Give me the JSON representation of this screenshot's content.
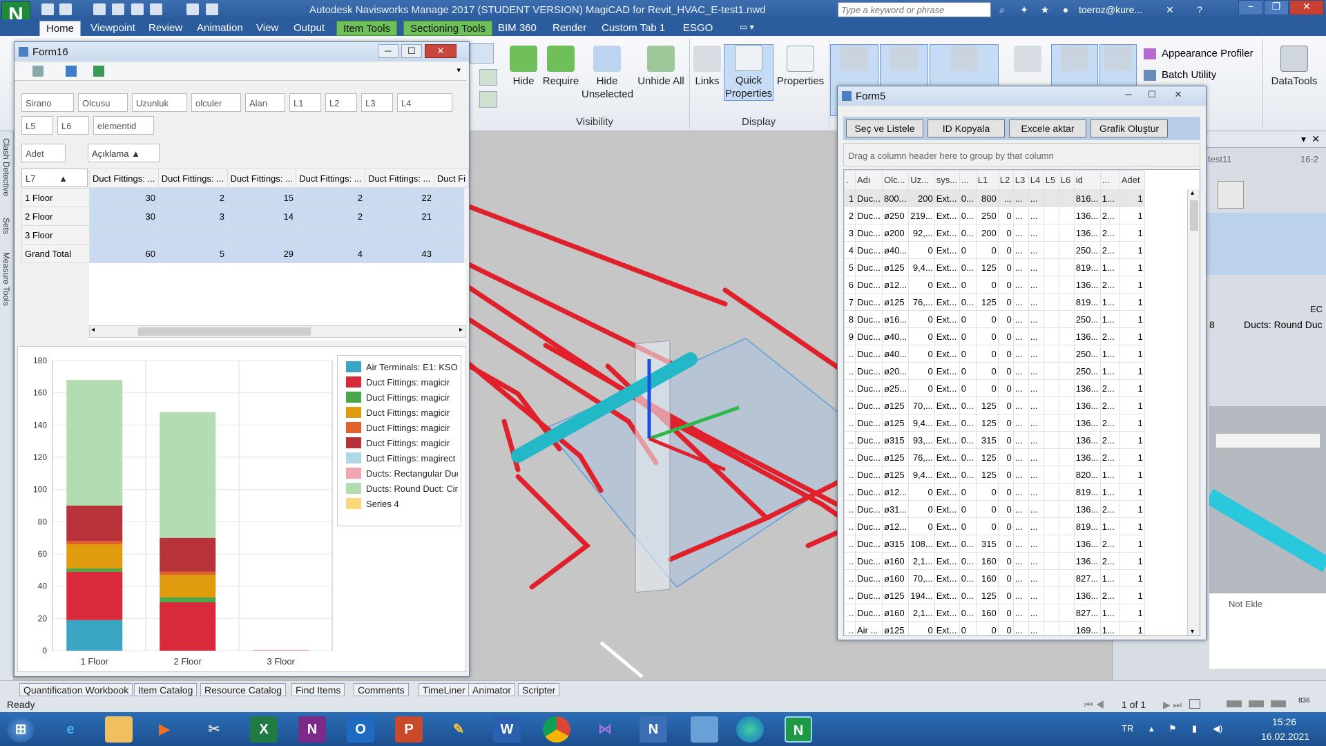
{
  "app": {
    "title": "Autodesk Navisworks Manage 2017 (STUDENT VERSION)    MagiCAD for Revit_HVAC_E-test1.nwd",
    "logo": "N",
    "search_placeholder": "Type a keyword or phrase",
    "user": "toeroz@kure...",
    "minimize": "−",
    "restore": "❐",
    "close": "✕"
  },
  "ribbon_tabs": [
    "Home",
    "Viewpoint",
    "Review",
    "Animation",
    "View",
    "Output",
    "Item Tools",
    "Sectioning Tools",
    "BIM 360",
    "Render",
    "Custom Tab 1",
    "ESGO"
  ],
  "ribbon": {
    "hide": "Hide",
    "require": "Require",
    "hide_unselected": "Hide Unselected",
    "unhide_all": "Unhide All",
    "links": "Links",
    "quick_properties": "Quick Properties",
    "properties": "Properties",
    "group_visibility": "Visibility",
    "group_display": "Display",
    "appearance_profiler": "Appearance Profiler",
    "batch_utility": "Batch Utility",
    "datatools": "DataTools"
  },
  "left_side_tabs": [
    "Clash Detective",
    "Sets",
    "Measure Tools"
  ],
  "form16": {
    "title": "Form16",
    "filter_fields": [
      "Sirano",
      "Olcusu",
      "Uzunluk",
      "olculer",
      "Alan",
      "L1",
      "L2",
      "L3",
      "L4",
      "L5",
      "L6",
      "elementid"
    ],
    "data_field": "Adet",
    "column_field": "Açıklama",
    "row_field": "L7",
    "column_headers": [
      "Duct Fittings: ...",
      "Duct Fittings: ...",
      "Duct Fittings: ...",
      "Duct Fittings: ...",
      "Duct Fittings: ...",
      "Duct Fi"
    ],
    "rows": [
      {
        "label": "1 Floor",
        "values": [
          "30",
          "2",
          "15",
          "2",
          "22",
          ""
        ]
      },
      {
        "label": "2 Floor",
        "values": [
          "30",
          "3",
          "14",
          "2",
          "21",
          ""
        ]
      },
      {
        "label": "3 Floor",
        "values": [
          "",
          "",
          "",
          "",
          "",
          ""
        ]
      },
      {
        "label": "Grand Total",
        "values": [
          "60",
          "5",
          "29",
          "4",
          "43",
          ""
        ]
      }
    ]
  },
  "chart_data": {
    "type": "bar",
    "stacked": true,
    "categories": [
      "1 Floor",
      "2 Floor",
      "3 Floor"
    ],
    "ylim": [
      0,
      180
    ],
    "yticks": [
      0,
      20,
      40,
      60,
      80,
      100,
      120,
      140,
      160,
      180
    ],
    "grid": true,
    "legend_position": "right",
    "series": [
      {
        "name": "Air Terminals: E1: KSO",
        "color": "#3aa6c4",
        "values": [
          19,
          0,
          0
        ]
      },
      {
        "name": "Duct Fittings:  magicir",
        "color": "#d92a3c",
        "values": [
          30,
          30,
          0
        ]
      },
      {
        "name": "Duct Fittings:  magicir",
        "color": "#4aa84a",
        "values": [
          2,
          3,
          0
        ]
      },
      {
        "name": "Duct Fittings:  magicir",
        "color": "#e19b0e",
        "values": [
          15,
          14,
          0
        ]
      },
      {
        "name": "Duct Fittings:  magicir",
        "color": "#e0622a",
        "values": [
          2,
          2,
          0
        ]
      },
      {
        "name": "Duct Fittings:  magicir",
        "color": "#b8323a",
        "values": [
          22,
          21,
          0
        ]
      },
      {
        "name": "Duct Fittings:  magirect",
        "color": "#add8e6",
        "values": [
          0,
          0,
          0
        ]
      },
      {
        "name": "Ducts: Rectangular Duc",
        "color": "#f2a5b0",
        "values": [
          0,
          0,
          0.5
        ]
      },
      {
        "name": "Ducts: Round Duct: Cir",
        "color": "#b3dcb3",
        "values": [
          78,
          78,
          0
        ]
      },
      {
        "name": "Series 4",
        "color": "#fbd77a",
        "values": [
          0,
          0,
          0
        ]
      }
    ]
  },
  "form5": {
    "title": "Form5",
    "buttons": [
      "Seç ve  Listele",
      "ID Kopyala",
      "Excele aktar",
      "Grafik Oluştur"
    ],
    "group_hint": "Drag a column header here to group by that column",
    "columns": [
      ".",
      "Adı",
      "Olc...",
      "Uz...",
      "sys...",
      "...",
      "L1",
      "L2",
      "L3",
      "L4",
      "L5",
      "L6",
      "id",
      "...",
      "Adet"
    ],
    "rows": [
      [
        "1",
        "Duc...",
        "800...",
        "200",
        "Ext...",
        "0...",
        "800",
        "...",
        "...",
        "...",
        "",
        "",
        "816...",
        "1...",
        "1"
      ],
      [
        "2",
        "Duc...",
        "ø250",
        "219...",
        "Ext...",
        "0...",
        "250",
        "0",
        "...",
        "...",
        "",
        "",
        "136...",
        "2...",
        "1"
      ],
      [
        "3",
        "Duc...",
        "ø200",
        "92,...",
        "Ext...",
        "0...",
        "200",
        "0",
        "...",
        "...",
        "",
        "",
        "136...",
        "2...",
        "1"
      ],
      [
        "4",
        "Duc...",
        "ø40...",
        "0",
        "Ext...",
        "0",
        "0",
        "0",
        "...",
        "...",
        "",
        "",
        "250...",
        "2...",
        "1"
      ],
      [
        "5",
        "Duc...",
        "ø125",
        "9,4...",
        "Ext...",
        "0...",
        "125",
        "0",
        "...",
        "...",
        "",
        "",
        "819...",
        "1...",
        "1"
      ],
      [
        "6",
        "Duc...",
        "ø12...",
        "0",
        "Ext...",
        "0",
        "0",
        "0",
        "...",
        "...",
        "",
        "",
        "136...",
        "2...",
        "1"
      ],
      [
        "7",
        "Duc...",
        "ø125",
        "76,...",
        "Ext...",
        "0...",
        "125",
        "0",
        "...",
        "...",
        "",
        "",
        "819...",
        "1...",
        "1"
      ],
      [
        "8",
        "Duc...",
        "ø16...",
        "0",
        "Ext...",
        "0",
        "0",
        "0",
        "...",
        "...",
        "",
        "",
        "250...",
        "1...",
        "1"
      ],
      [
        "9",
        "Duc...",
        "ø40...",
        "0",
        "Ext...",
        "0",
        "0",
        "0",
        "...",
        "...",
        "",
        "",
        "136...",
        "2...",
        "1"
      ],
      [
        "..",
        "Duc...",
        "ø40...",
        "0",
        "Ext...",
        "0",
        "0",
        "0",
        "...",
        "...",
        "",
        "",
        "250...",
        "1...",
        "1"
      ],
      [
        "..",
        "Duc...",
        "ø20...",
        "0",
        "Ext...",
        "0",
        "0",
        "0",
        "...",
        "...",
        "",
        "",
        "250...",
        "1...",
        "1"
      ],
      [
        "..",
        "Duc...",
        "ø25...",
        "0",
        "Ext...",
        "0",
        "0",
        "0",
        "...",
        "...",
        "",
        "",
        "136...",
        "2...",
        "1"
      ],
      [
        "..",
        "Duc...",
        "ø125",
        "70,...",
        "Ext...",
        "0...",
        "125",
        "0",
        "...",
        "...",
        "",
        "",
        "136...",
        "2...",
        "1"
      ],
      [
        "..",
        "Duc...",
        "ø125",
        "9,4...",
        "Ext...",
        "0...",
        "125",
        "0",
        "...",
        "...",
        "",
        "",
        "136...",
        "2...",
        "1"
      ],
      [
        "..",
        "Duc...",
        "ø315",
        "93,...",
        "Ext...",
        "0...",
        "315",
        "0",
        "...",
        "...",
        "",
        "",
        "136...",
        "2...",
        "1"
      ],
      [
        "..",
        "Duc...",
        "ø125",
        "76,...",
        "Ext...",
        "0...",
        "125",
        "0",
        "...",
        "...",
        "",
        "",
        "136...",
        "2...",
        "1"
      ],
      [
        "..",
        "Duc...",
        "ø125",
        "9,4...",
        "Ext...",
        "0...",
        "125",
        "0",
        "...",
        "...",
        "",
        "",
        "820...",
        "1...",
        "1"
      ],
      [
        "..",
        "Duc...",
        "ø12...",
        "0",
        "Ext...",
        "0",
        "0",
        "0",
        "...",
        "...",
        "",
        "",
        "819...",
        "1...",
        "1"
      ],
      [
        "..",
        "Duc...",
        "ø31...",
        "0",
        "Ext...",
        "0",
        "0",
        "0",
        "...",
        "...",
        "",
        "",
        "136...",
        "2...",
        "1"
      ],
      [
        "..",
        "Duc...",
        "ø12...",
        "0",
        "Ext...",
        "0",
        "0",
        "0",
        "...",
        "...",
        "",
        "",
        "819...",
        "1...",
        "1"
      ],
      [
        "..",
        "Duc...",
        "ø315",
        "108...",
        "Ext...",
        "0...",
        "315",
        "0",
        "...",
        "...",
        "",
        "",
        "136...",
        "2...",
        "1"
      ],
      [
        "..",
        "Duc...",
        "ø160",
        "2,1...",
        "Ext...",
        "0...",
        "160",
        "0",
        "...",
        "...",
        "",
        "",
        "136...",
        "2...",
        "1"
      ],
      [
        "..",
        "Duc...",
        "ø160",
        "70,...",
        "Ext...",
        "0...",
        "160",
        "0",
        "...",
        "...",
        "",
        "",
        "827...",
        "1...",
        "1"
      ],
      [
        "..",
        "Duc...",
        "ø125",
        "194...",
        "Ext...",
        "0...",
        "125",
        "0",
        "...",
        "...",
        "",
        "",
        "136...",
        "2...",
        "1"
      ],
      [
        "..",
        "Duc...",
        "ø160",
        "2,1...",
        "Ext...",
        "0...",
        "160",
        "0",
        "...",
        "...",
        "",
        "",
        "827...",
        "1...",
        "1"
      ],
      [
        "..",
        "Air ...",
        "ø125",
        "0",
        "Ext...",
        "0",
        "0",
        "0",
        "...",
        "...",
        "",
        "",
        "169...",
        "1...",
        "1"
      ]
    ]
  },
  "right_panel": {
    "file_label": "test11",
    "date_label": "16-2",
    "ec_label": "EC",
    "count_label": "8",
    "ducts_label": "Ducts: Round Duc",
    "note_label": "Not Ekle"
  },
  "bottom_tabs": [
    "Quantification Workbook",
    "Item Catalog",
    "Resource Catalog",
    "Find Items",
    "Comments",
    "TimeLiner",
    "Animator",
    "Scripter"
  ],
  "status": {
    "ready": "Ready",
    "page": "1 of 1",
    "memory": "836"
  },
  "taskbar": {
    "lang": "TR",
    "time": "15:26",
    "date": "16.02.2021"
  }
}
